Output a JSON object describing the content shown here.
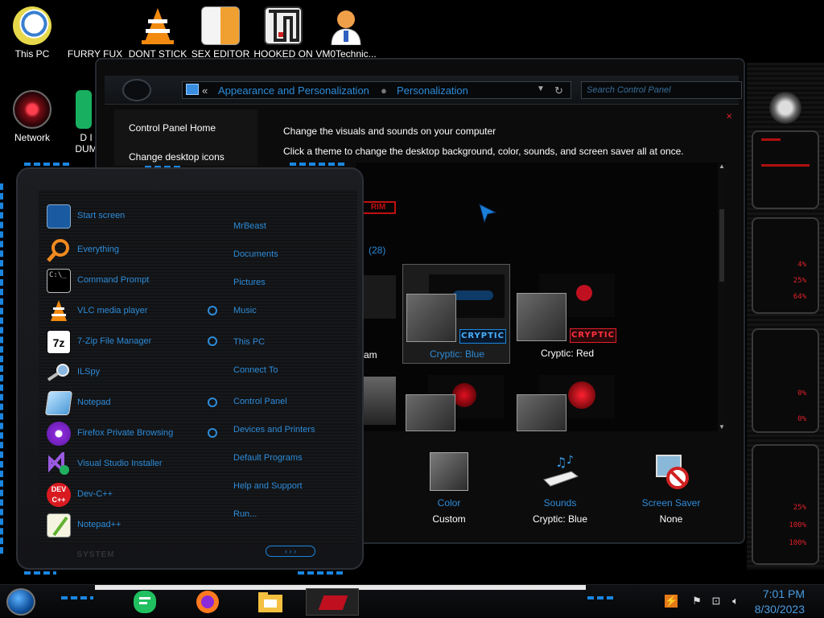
{
  "desktop": {
    "icons": [
      {
        "label": "This PC"
      },
      {
        "label": "FURRY FUX"
      },
      {
        "label": "DONT STICK"
      },
      {
        "label": "SEX EDITOR"
      },
      {
        "label": "HOOKED ON"
      },
      {
        "label": "VM0Technic..."
      },
      {
        "label": "Network"
      },
      {
        "label": "D I DUM"
      }
    ]
  },
  "control_panel": {
    "breadcrumb": {
      "back_glyph": "«",
      "level1": "Appearance and Personalization",
      "level2": "Personalization"
    },
    "search_placeholder": "Search Control Panel",
    "sidebar": {
      "links": [
        "Control Panel Home",
        "Change desktop icons"
      ]
    },
    "heading": "Change the visuals and sounds on your computer",
    "subheading": "Click a theme to change the desktop background, color, sounds, and screen saver all at once.",
    "partial_count": "(28)",
    "partial_theme_label": "am",
    "theme_brand_text": "RIM",
    "themes": [
      {
        "name": "Cryptic: Blue",
        "badge": "CRYPTIC",
        "accent": "#1a86e0",
        "selected": true
      },
      {
        "name": "Cryptic: Red",
        "badge": "CRYPTIC",
        "accent": "#e0202a",
        "selected": false
      }
    ],
    "bottom": {
      "background": {
        "top": "und",
        "bottom": ""
      },
      "color": {
        "top": "Color",
        "bottom": "Custom"
      },
      "sounds": {
        "top": "Sounds",
        "bottom": "Cryptic: Blue"
      },
      "screensaver": {
        "top": "Screen Saver",
        "bottom": "None"
      }
    }
  },
  "start_menu": {
    "apps": [
      {
        "label": "Start screen",
        "icon": "start-screen-icon",
        "arrow": false
      },
      {
        "label": "Everything",
        "icon": "search-magnifier-icon",
        "arrow": false
      },
      {
        "label": "Command Prompt",
        "icon": "command-prompt-icon",
        "arrow": false
      },
      {
        "label": "VLC media player",
        "icon": "vlc-cone-icon",
        "arrow": true
      },
      {
        "label": "7-Zip File Manager",
        "icon": "7zip-icon",
        "arrow": true
      },
      {
        "label": "ILSpy",
        "icon": "ilspy-icon",
        "arrow": false
      },
      {
        "label": "Notepad",
        "icon": "notepad-icon",
        "arrow": true
      },
      {
        "label": "Firefox Private Browsing",
        "icon": "firefox-private-icon",
        "arrow": true
      },
      {
        "label": "Visual Studio Installer",
        "icon": "visual-studio-icon",
        "arrow": false
      },
      {
        "label": "Dev-C++",
        "icon": "devcpp-icon",
        "arrow": false
      },
      {
        "label": "Notepad++",
        "icon": "notepadpp-icon",
        "arrow": false
      }
    ],
    "places": [
      "MrBeast",
      "Documents",
      "Pictures",
      "Music",
      "This PC",
      "Connect To",
      "Control Panel",
      "Devices and Printers",
      "Default Programs",
      "Help and Support",
      "Run..."
    ],
    "footer_badge": "SYSTEM"
  },
  "right_panel": {
    "readouts": [
      "4%",
      "25%",
      "64%",
      "0%",
      "0%",
      "25%",
      "100%",
      "100%"
    ]
  },
  "taskbar": {
    "time": "7:01 PM",
    "date": "8/30/2023"
  }
}
